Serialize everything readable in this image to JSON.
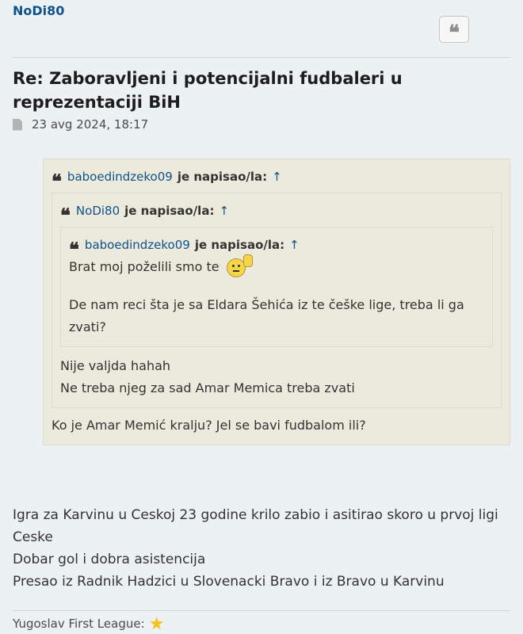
{
  "post": {
    "author": "NoDi80",
    "quote_button_icon": "quote-icon",
    "title": "Re: Zaboravljeni i potencijalni fudbaleri u reprezentaciji BiH",
    "date": "23 avg 2024, 18:17"
  },
  "quotes": {
    "level1": {
      "user": "baboedindzeko09",
      "wrote": "je napisao/la:",
      "arrow": "↑",
      "text": "Ko je Amar Memić kralju? Jel se bavi fudbalom ili?"
    },
    "level2": {
      "user": "NoDi80",
      "wrote": "je napisao/la:",
      "arrow": "↑",
      "line1": "Nije valjda hahah",
      "line2": "Ne treba njeg za sad Amar Memica treba zvati"
    },
    "level3": {
      "user": "baboedindzeko09",
      "wrote": "je napisao/la:",
      "arrow": "↑",
      "line1": "Brat moj poželili smo te",
      "line2": "De nam reci šta je sa Eldara Šehića iz te češke lige, treba li ga zvati?"
    }
  },
  "body": {
    "line1": "Igra za Karvinu u Ceskoj 23 godine krilo zabio i asitirao skoro u prvoj ligi Ceske",
    "line2": "Dobar gol i dobra asistencija",
    "line3": "Presao iz Radnik Hadzici u Slovenacki Bravo i iz Bravo u Karvinu"
  },
  "signature": {
    "text": "Yugoslav First League:"
  }
}
